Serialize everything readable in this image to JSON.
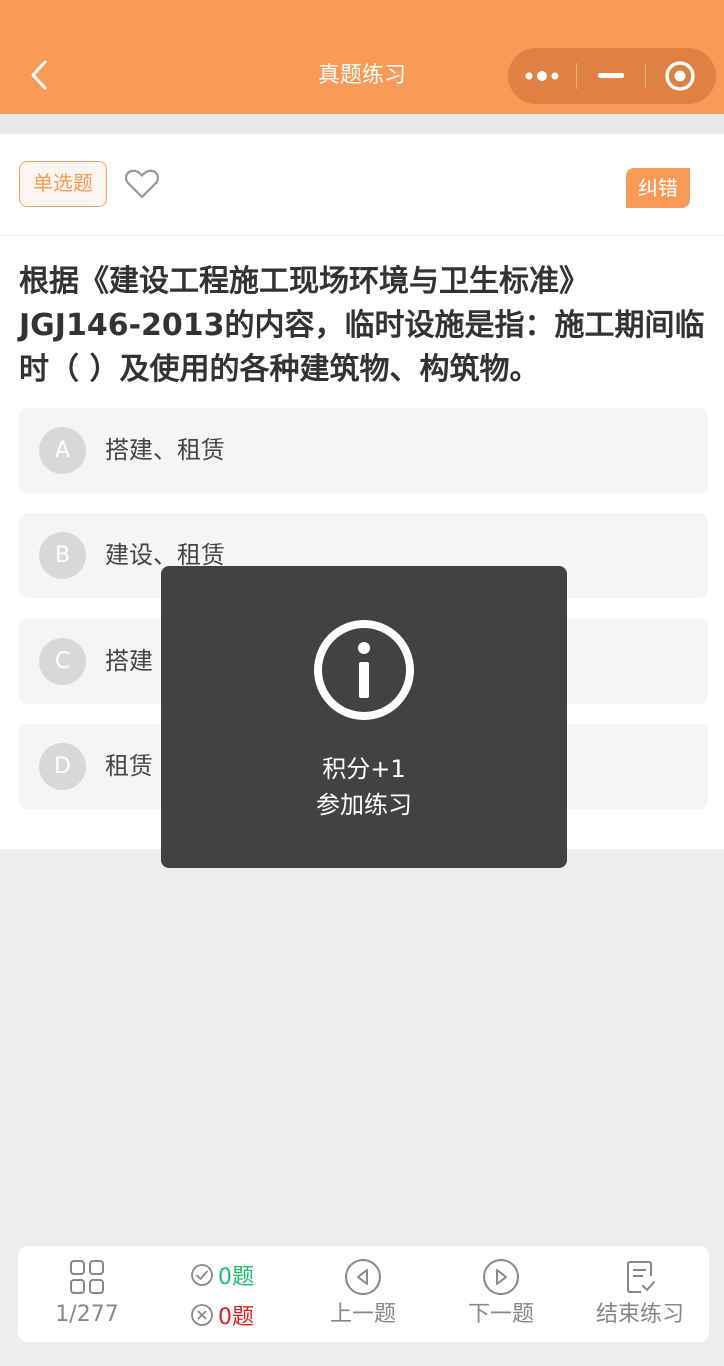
{
  "header": {
    "title": "真题练习",
    "back_icon": "chevron-left-icon",
    "capsule": {
      "more_icon": "more-dots-icon",
      "minimize_icon": "minus-icon",
      "close_icon": "target-icon"
    }
  },
  "question": {
    "type": "单选题",
    "favorite_icon": "heart-outline-icon",
    "report_label": "纠错",
    "text": "根据《建设工程施工现场环境与卫生标准》JGJ146-2013的内容，临时设施是指：施工期间临时（ ）及使用的各种建筑物、构筑物。",
    "options": [
      {
        "letter": "A",
        "text": "搭建、租赁"
      },
      {
        "letter": "B",
        "text": "建设、租赁"
      },
      {
        "letter": "C",
        "text": "搭建"
      },
      {
        "letter": "D",
        "text": "租赁"
      }
    ]
  },
  "toast": {
    "icon": "info-circle-icon",
    "line1": "积分+1",
    "line2": "参加练习"
  },
  "bottom_bar": {
    "progress": "1/277",
    "correct": "0题",
    "wrong": "0题",
    "prev_label": "上一题",
    "next_label": "下一题",
    "finish_label": "结束练习"
  },
  "colors": {
    "accent": "#f99a57",
    "correct": "#19be6b",
    "wrong": "#e02020"
  }
}
